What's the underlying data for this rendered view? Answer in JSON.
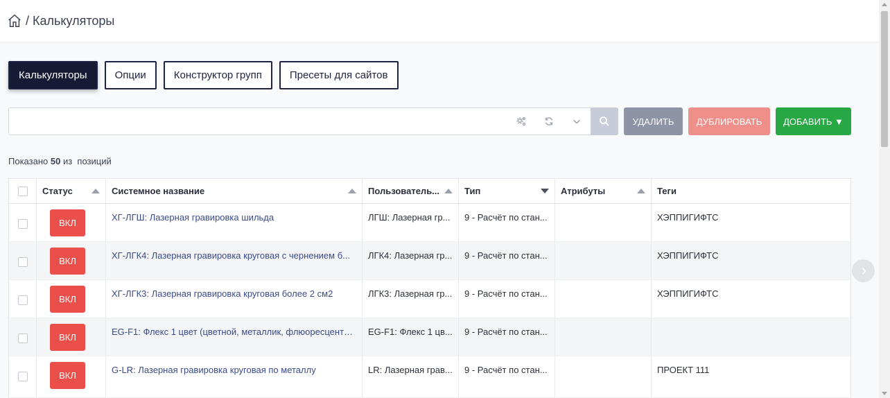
{
  "breadcrumb": {
    "separator": "/",
    "current": "Калькуляторы"
  },
  "tabs": [
    {
      "label": "Калькуляторы",
      "active": true
    },
    {
      "label": "Опции",
      "active": false
    },
    {
      "label": "Конструктор групп",
      "active": false
    },
    {
      "label": "Пресеты для сайтов",
      "active": false
    }
  ],
  "search": {
    "value": "",
    "placeholder": ""
  },
  "actions": {
    "delete": "Удалить",
    "duplicate": "Дублировать",
    "add": "Добавить ▼"
  },
  "summary": {
    "prefix": "Показано",
    "count": "50",
    "of": "из",
    "suffix": "позиций"
  },
  "table": {
    "columns": [
      "Статус",
      "Системное название",
      "Пользователь...",
      "Тип",
      "Атрибуты",
      "Теги"
    ],
    "rows": [
      {
        "status": "ВКЛ",
        "system_name": "ХГ-ЛГШ: Лазерная гравировка шильда",
        "user_name": "ЛГШ: Лазерная гр...",
        "type": "9 - Расчёт по стан...",
        "attributes": "",
        "tags": "ХЭППИГИФТС"
      },
      {
        "status": "ВКЛ",
        "system_name": "ХГ-ЛГК4: Лазерная гравировка круговая с чернением б...",
        "user_name": "ЛГК4: Лазерная гр...",
        "type": "9 - Расчёт по стан...",
        "attributes": "",
        "tags": "ХЭППИГИФТС"
      },
      {
        "status": "ВКЛ",
        "system_name": "ХГ-ЛГК3: Лазерная гравировка круговая более 2 см2",
        "user_name": "ЛГК3: Лазерная гр...",
        "type": "9 - Расчёт по стан...",
        "attributes": "",
        "tags": "ХЭППИГИФТС"
      },
      {
        "status": "ВКЛ",
        "system_name": "EG-F1: Флекс 1 цвет (цветной, металлик, флюоресцентн...",
        "user_name": "EG-F1: Флекс 1 цв...",
        "type": "9 - Расчёт по стан...",
        "attributes": "",
        "tags": ""
      },
      {
        "status": "ВКЛ",
        "system_name": "G-LR: Лазерная гравировка круговая по металлу",
        "user_name": "LR: Лазерная грав...",
        "type": "9 - Расчёт по стан...",
        "attributes": "",
        "tags": "ПРОЕКТ 111"
      }
    ]
  },
  "colors": {
    "tab_active": "#171a35",
    "status_on": "#ea4f4a",
    "delete": "#8e93a6",
    "duplicate": "#ef8f8a",
    "add": "#28a745"
  },
  "icons": {
    "home": "home-icon",
    "settings": "gears-icon",
    "refresh": "refresh-icon",
    "dropdown": "chevron-down-icon",
    "search": "search-icon",
    "next": "chevron-right-icon"
  }
}
